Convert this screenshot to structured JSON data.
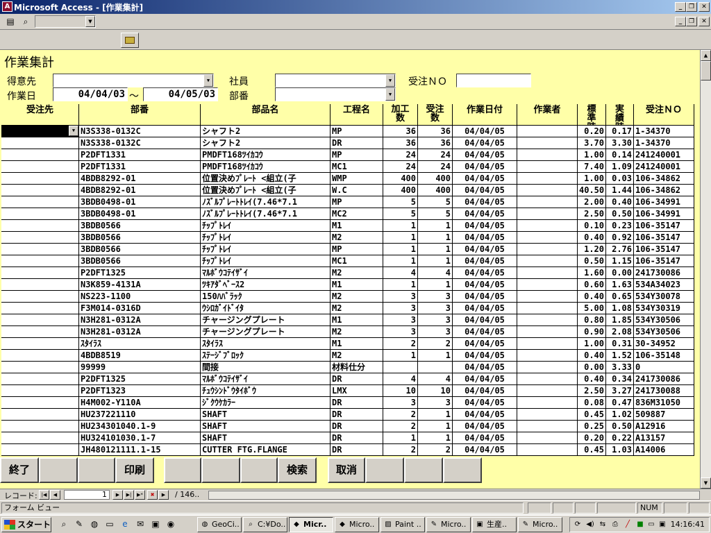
{
  "window": {
    "title": "Microsoft Access - [作業集計]",
    "app_icon": "access-icon",
    "controls": [
      "minimize",
      "restore",
      "close"
    ]
  },
  "toolbar": {
    "form_view_icon": "form-view-icon",
    "search_icon": "magnifier-icon",
    "combo_value": "",
    "open_icon": "folder-open-icon"
  },
  "form": {
    "heading": "作業集計",
    "labels": {
      "customer": "得意先",
      "employee": "社員",
      "order_no": "受注ＮＯ",
      "work_date": "作業日",
      "tilde": "～",
      "part_no": "部番"
    },
    "values": {
      "customer": "",
      "employee": "",
      "order_no": "",
      "date_from": "04/04/03",
      "date_to": "04/05/03",
      "part_no": ""
    }
  },
  "table": {
    "columns": [
      "受注先",
      "部番",
      "部品名",
      "工程名",
      "加工数",
      "受注数",
      "作業日付",
      "作業者",
      "標準時間",
      "実績時間",
      "受注ＮＯ"
    ],
    "rows": [
      [
        "",
        "N3S338-0132C",
        "シャフト2",
        "MP",
        "36",
        "36",
        "04/04/05",
        "",
        "0.20",
        "0.17",
        "1-34370"
      ],
      [
        "",
        "N3S338-0132C",
        "シャフト2",
        "DR",
        "36",
        "36",
        "04/04/05",
        "",
        "3.70",
        "3.30",
        "1-34370"
      ],
      [
        "",
        "P2DFT1331",
        "PMDFT168ﾂｲｶｺｳ",
        "MP",
        "24",
        "24",
        "04/04/05",
        "",
        "1.00",
        "0.14",
        "241240001"
      ],
      [
        "",
        "P2DFT1331",
        "PMDFT168ﾂｲｶｺｳ",
        "MC1",
        "24",
        "24",
        "04/04/05",
        "",
        "7.40",
        "1.09",
        "241240001"
      ],
      [
        "",
        "4BDB8292-01",
        "位置決めﾌﾟﾚｰﾄ <組立(子",
        "WMP",
        "400",
        "400",
        "04/04/05",
        "",
        "1.00",
        "0.03",
        "106-34862"
      ],
      [
        "",
        "4BDB8292-01",
        "位置決めﾌﾟﾚｰﾄ <組立(子",
        "W.C",
        "400",
        "400",
        "04/04/05",
        "",
        "40.50",
        "1.44",
        "106-34862"
      ],
      [
        "",
        "3BDB0498-01",
        "ﾉｽﾞﾙﾌﾟﾚｰﾄﾄﾚｲ(7.46*7.1",
        "MP",
        "5",
        "5",
        "04/04/05",
        "",
        "2.00",
        "0.40",
        "106-34991"
      ],
      [
        "",
        "3BDB0498-01",
        "ﾉｽﾞﾙﾌﾟﾚｰﾄﾄﾚｲ(7.46*7.1",
        "MC2",
        "5",
        "5",
        "04/04/05",
        "",
        "2.50",
        "0.50",
        "106-34991"
      ],
      [
        "",
        "3BDB0566",
        "ﾁｯﾌﾟﾄﾚｲ",
        "M1",
        "1",
        "1",
        "04/04/05",
        "",
        "0.10",
        "0.23",
        "106-35147"
      ],
      [
        "",
        "3BDB0566",
        "ﾁｯﾌﾟﾄﾚｲ",
        "M2",
        "1",
        "1",
        "04/04/05",
        "",
        "0.40",
        "0.92",
        "106-35147"
      ],
      [
        "",
        "3BDB0566",
        "ﾁｯﾌﾟﾄﾚｲ",
        "MP",
        "1",
        "1",
        "04/04/05",
        "",
        "1.20",
        "2.76",
        "106-35147"
      ],
      [
        "",
        "3BDB0566",
        "ﾁｯﾌﾟﾄﾚｲ",
        "MC1",
        "1",
        "1",
        "04/04/05",
        "",
        "0.50",
        "1.15",
        "106-35147"
      ],
      [
        "",
        "P2DFT1325",
        "ﾏﾙﾎﾞｳｺﾃｲｻﾞｲ",
        "M2",
        "4",
        "4",
        "04/04/05",
        "",
        "1.60",
        "0.00",
        "241730086"
      ],
      [
        "",
        "N3K859-4131A",
        "ﾂｷｱﾀﾞﾍﾞｰｽ2",
        "M1",
        "1",
        "1",
        "04/04/05",
        "",
        "0.60",
        "1.63",
        "534A34023"
      ],
      [
        "",
        "NS223-1100",
        "150ﾊﾊﾞﾗｯｸ",
        "M2",
        "3",
        "3",
        "04/04/05",
        "",
        "0.40",
        "0.65",
        "534Y30078"
      ],
      [
        "",
        "F3M014-0316D",
        "ｳｼﾛｶﾞｲﾄﾞｲﾀ",
        "M2",
        "3",
        "3",
        "04/04/05",
        "",
        "5.00",
        "1.08",
        "534Y30319"
      ],
      [
        "",
        "N3H281-0312A",
        "チャージングプレート",
        "M1",
        "3",
        "3",
        "04/04/05",
        "",
        "0.80",
        "1.85",
        "534Y30506"
      ],
      [
        "",
        "N3H281-0312A",
        "チャージングプレート",
        "M2",
        "3",
        "3",
        "04/04/05",
        "",
        "0.90",
        "2.08",
        "534Y30506"
      ],
      [
        "",
        "ｽﾀｲﾗｽ",
        "ｽﾀｲﾗｽ",
        "M1",
        "2",
        "2",
        "04/04/05",
        "",
        "1.00",
        "0.31",
        "30-34952"
      ],
      [
        "",
        "4BDB8519",
        "ｽﾃｰｼﾞﾌﾞﾛｯｸ",
        "M2",
        "1",
        "1",
        "04/04/05",
        "",
        "0.40",
        "1.52",
        "106-35148"
      ],
      [
        "",
        "99999",
        "間接",
        "材料仕分",
        "",
        "",
        "04/04/05",
        "",
        "0.00",
        "3.33",
        "0"
      ],
      [
        "",
        "P2DFT1325",
        "ﾏﾙﾎﾞｳｺﾃｲｻﾞｲ",
        "DR",
        "4",
        "4",
        "04/04/05",
        "",
        "0.40",
        "0.34",
        "241730086"
      ],
      [
        "",
        "P2DFT1323",
        "ﾁｭｳｼﾝﾄﾞｳﾀｲﾎﾞｳ",
        "LMX",
        "10",
        "10",
        "04/04/05",
        "",
        "2.50",
        "3.27",
        "241730088"
      ],
      [
        "",
        "H4M002-Y110A",
        "ｼﾞｸｳｹｶﾗｰ",
        "DR",
        "3",
        "3",
        "04/04/05",
        "",
        "0.08",
        "0.47",
        "836M31050"
      ],
      [
        "",
        "HU237221110",
        "SHAFT",
        "DR",
        "2",
        "1",
        "04/04/05",
        "",
        "0.45",
        "1.02",
        "509887"
      ],
      [
        "",
        "HU234301040.1-9",
        "SHAFT",
        "DR",
        "2",
        "1",
        "04/04/05",
        "",
        "0.25",
        "0.50",
        "A12916"
      ],
      [
        "",
        "HU324101030.1-7",
        "SHAFT",
        "DR",
        "1",
        "1",
        "04/04/05",
        "",
        "0.20",
        "0.22",
        "A13157"
      ],
      [
        "",
        "JH480121111.1-15",
        "CUTTER FTG.FLANGE",
        "DR",
        "2",
        "2",
        "04/04/05",
        "",
        "0.45",
        "1.03",
        "A14006"
      ]
    ]
  },
  "buttons": {
    "exit": "終了",
    "print": "印刷",
    "search": "検索",
    "cancel": "取消"
  },
  "record_nav": {
    "label": "レコード:",
    "current": "1",
    "total": "/ 146.."
  },
  "status_bar": {
    "view": "フォーム ビュー",
    "num": "NUM"
  },
  "taskbar": {
    "start": "スタート",
    "tasks": [
      "GeoCi..",
      "C:¥Do..",
      "Micr..",
      "Micro..",
      "Paint ..",
      "Micro..",
      "生産..",
      "Micro.."
    ],
    "active_index": 2,
    "clock": "14:16:41"
  }
}
